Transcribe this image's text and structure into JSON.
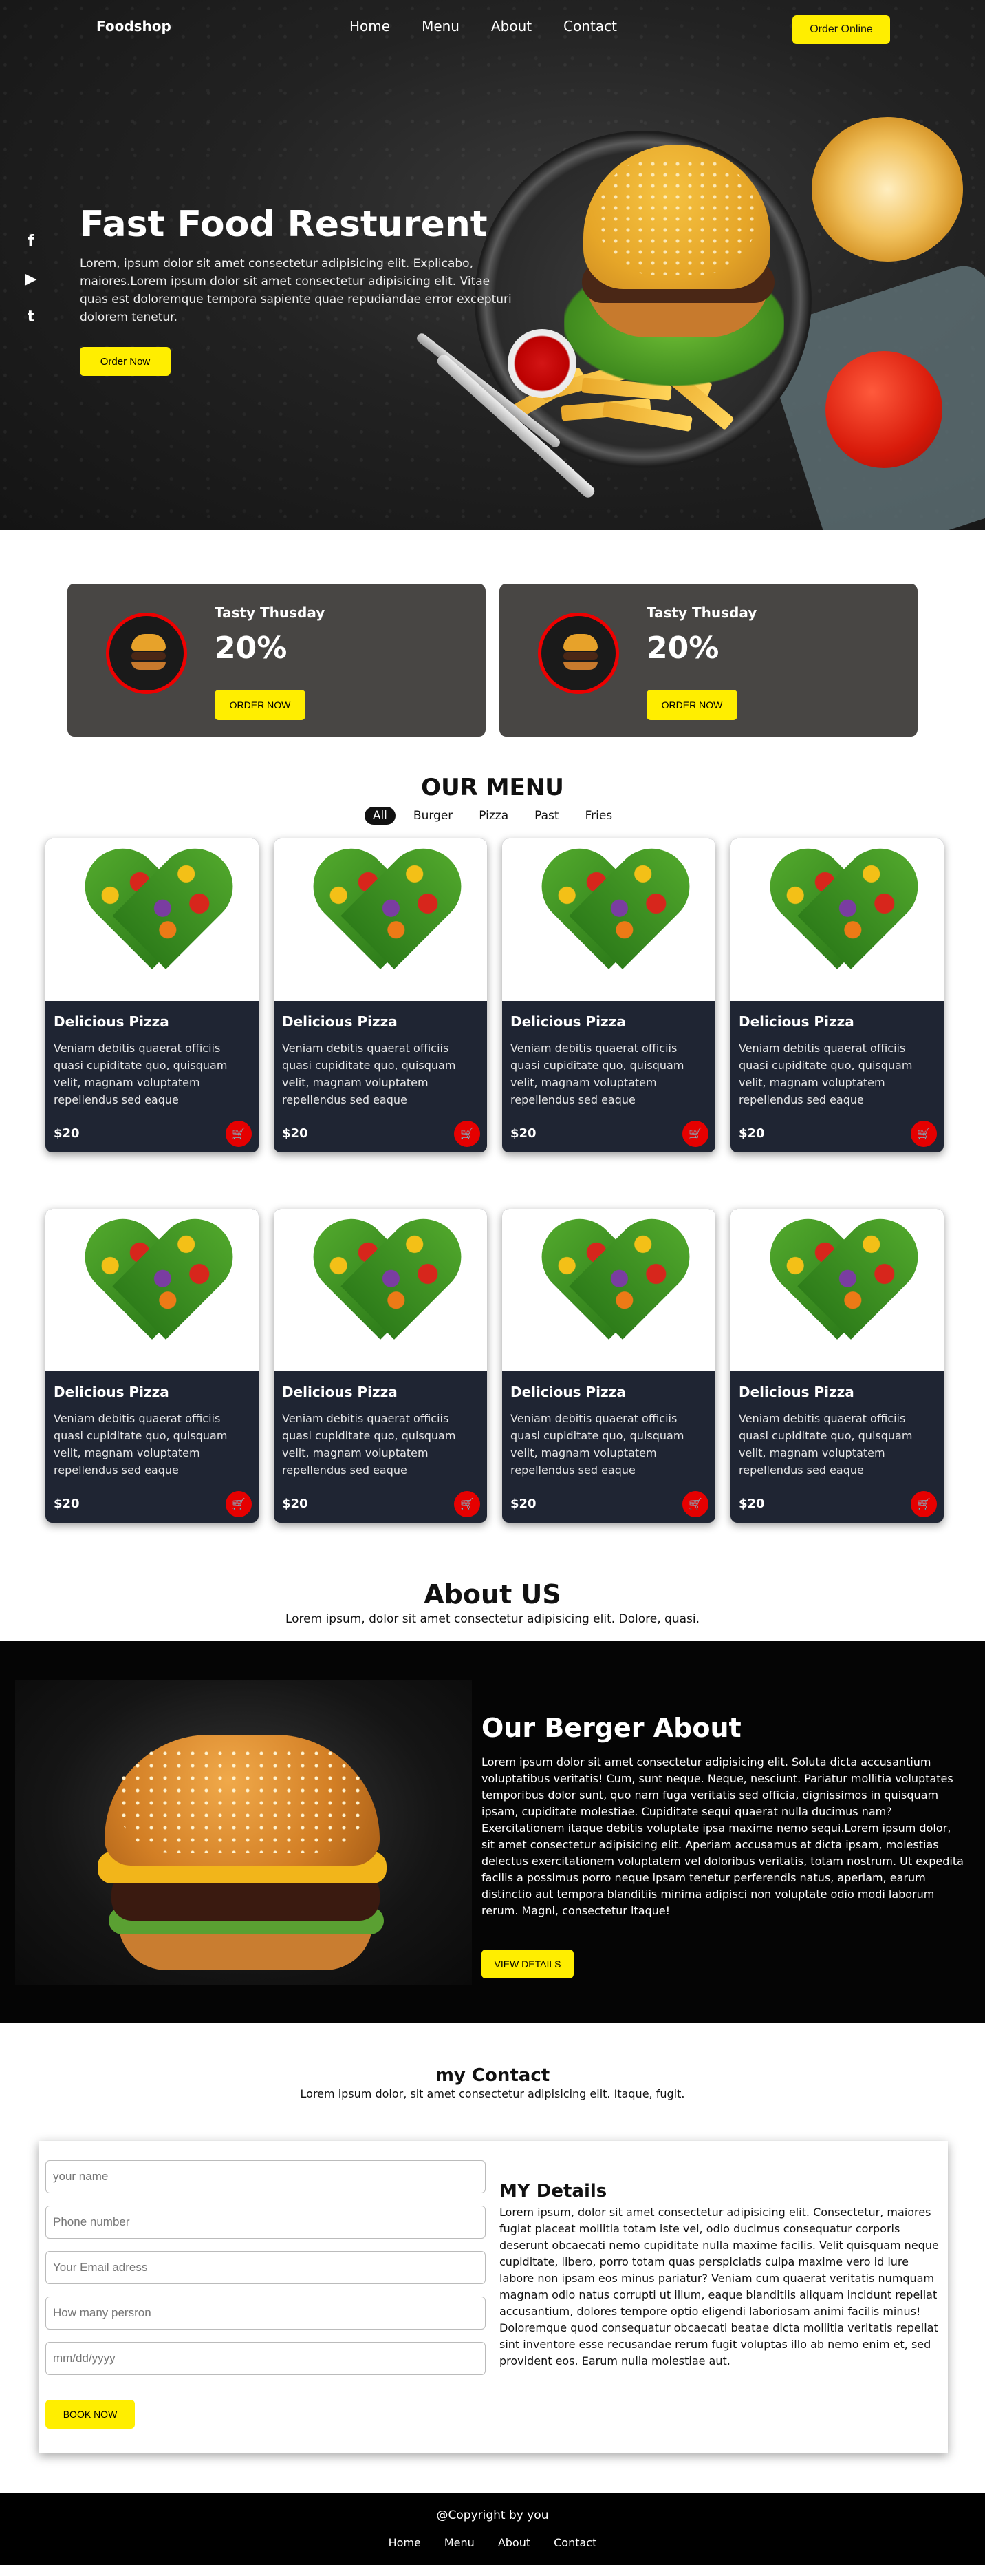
{
  "header": {
    "brand": "Foodshop",
    "nav": [
      "Home",
      "Menu",
      "About",
      "Contact"
    ],
    "order_online": "Order Online"
  },
  "social": {
    "facebook": "f",
    "youtube": "▶",
    "twitter": "t",
    "icons": [
      "facebook-icon",
      "youtube-icon",
      "twitter-icon"
    ]
  },
  "hero": {
    "title": "Fast Food Resturent",
    "text": "Lorem, ipsum dolor sit amet consectetur adipisicing elit. Explicabo, maiores.Lorem ipsum dolor sit amet consectetur adipisicing elit. Vitae quas est doloremque tempora sapiente quae repudiandae error excepturi dolorem tenetur.",
    "button": "Order Now"
  },
  "offers": [
    {
      "title": "Tasty Thusday",
      "discount": "20%",
      "button": "ORDER NOW"
    },
    {
      "title": "Tasty Thusday",
      "discount": "20%",
      "button": "ORDER NOW"
    }
  ],
  "menu": {
    "title": "OUR MENU",
    "filters": [
      "All",
      "Burger",
      "Pizza",
      "Past",
      "Fries"
    ],
    "items": [
      {
        "title": "Delicious Pizza",
        "text": "Veniam debitis quaerat officiis quasi cupiditate quo, quisquam velit, magnam voluptatem repellendus sed eaque",
        "price": "$20"
      },
      {
        "title": "Delicious Pizza",
        "text": "Veniam debitis quaerat officiis quasi cupiditate quo, quisquam velit, magnam voluptatem repellendus sed eaque",
        "price": "$20"
      },
      {
        "title": "Delicious Pizza",
        "text": "Veniam debitis quaerat officiis quasi cupiditate quo, quisquam velit, magnam voluptatem repellendus sed eaque",
        "price": "$20"
      },
      {
        "title": "Delicious Pizza",
        "text": "Veniam debitis quaerat officiis quasi cupiditate quo, quisquam velit, magnam voluptatem repellendus sed eaque",
        "price": "$20"
      },
      {
        "title": "Delicious Pizza",
        "text": "Veniam debitis quaerat officiis quasi cupiditate quo, quisquam velit, magnam voluptatem repellendus sed eaque",
        "price": "$20"
      },
      {
        "title": "Delicious Pizza",
        "text": "Veniam debitis quaerat officiis quasi cupiditate quo, quisquam velit, magnam voluptatem repellendus sed eaque",
        "price": "$20"
      },
      {
        "title": "Delicious Pizza",
        "text": "Veniam debitis quaerat officiis quasi cupiditate quo, quisquam velit, magnam voluptatem repellendus sed eaque",
        "price": "$20"
      },
      {
        "title": "Delicious Pizza",
        "text": "Veniam debitis quaerat officiis quasi cupiditate quo, quisquam velit, magnam voluptatem repellendus sed eaque",
        "price": "$20"
      }
    ]
  },
  "about": {
    "title": "About US",
    "subtitle": "Lorem ipsum, dolor sit amet consectetur adipisicing elit. Dolore, quasi.",
    "heading": "Our Berger About",
    "text": "Lorem ipsum dolor sit amet consectetur adipisicing elit. Soluta dicta accusantium voluptatibus veritatis! Cum, sunt neque. Neque, nesciunt. Pariatur mollitia voluptates temporibus dolor sunt, quo nam fuga veritatis sed officia, dignissimos in quisquam ipsam, cupiditate molestiae. Cupiditate sequi quaerat nulla ducimus nam? Exercitationem itaque debitis voluptate ipsa maxime nemo sequi.Lorem ipsum dolor, sit amet consectetur adipisicing elit. Aperiam accusamus at dicta ipsam, molestias delectus exercitationem voluptatem vel doloribus veritatis, totam nostrum. Ut expedita facilis a possimus porro neque ipsam tenetur perferendis natus, aperiam, earum distinctio aut tempora blanditiis minima adipisci non voluptate odio modi laborum rerum. Magni, consectetur itaque!",
    "button": "VIEW DETAILS"
  },
  "contact": {
    "title": "my Contact",
    "subtitle": "Lorem ipsum dolor, sit amet consectetur adipisicing elit. Itaque, fugit.",
    "placeholders": {
      "name": "your name",
      "phone": "Phone number",
      "email": "Your Email adress",
      "persons": "How many persron",
      "date": "mm/dd/yyyy"
    },
    "button": "BOOK NOW",
    "details_title": "MY Details",
    "details_text": "Lorem ipsum, dolor sit amet consectetur adipisicing elit. Consectetur, maiores fugiat placeat mollitia totam iste vel, odio ducimus consequatur corporis deserunt obcaecati nemo cupiditate nulla maxime facilis. Velit quisquam neque cupiditate, libero, porro totam quas perspiciatis culpa maxime vero id iure labore non ipsam eos minus pariatur? Veniam cum quaerat veritatis numquam magnam odio natus corrupti ut illum, eaque blanditiis aliquam incidunt repellat accusantium, dolores tempore optio eligendi laboriosam animi facilis minus! Doloremque quod consequatur obcaecati beatae dicta mollitia veritatis repellat sint inventore esse recusandae rerum fugit voluptas illo ab nemo enim et, sed provident eos. Earum nulla molestiae aut."
  },
  "footer": {
    "copyright": "@Copyright by you",
    "links": [
      "Home",
      "Menu",
      "About",
      "Contact"
    ]
  },
  "colors": {
    "accent": "#ffee00",
    "cart": "#e60000",
    "card_bg": "#1f2533",
    "offer_bg": "#484644"
  }
}
